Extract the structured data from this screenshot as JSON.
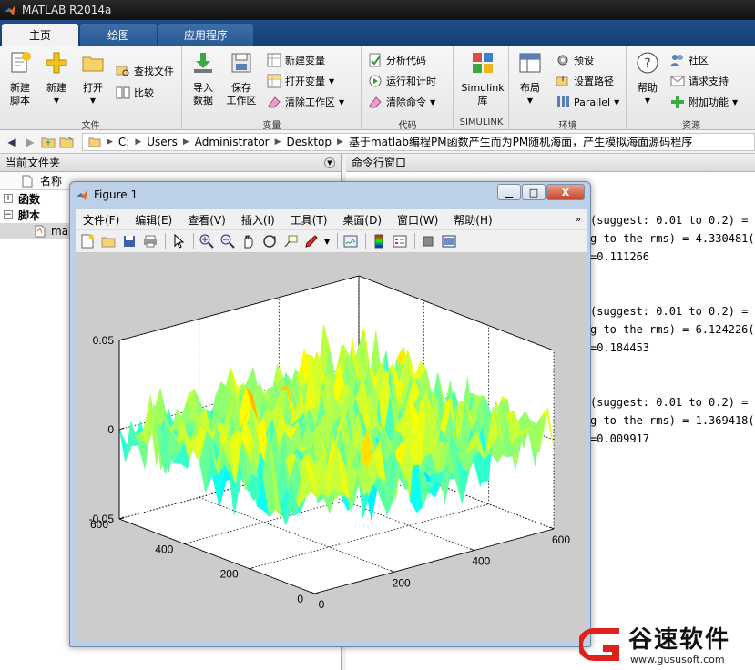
{
  "app": {
    "title": "MATLAB R2014a"
  },
  "tabs": [
    {
      "label": "主页",
      "active": true
    },
    {
      "label": "绘图",
      "active": false
    },
    {
      "label": "应用程序",
      "active": false
    }
  ],
  "ribbon": {
    "file": {
      "label": "文件",
      "new_script": "新建\n脚本",
      "new": "新建",
      "open": "打开",
      "find_files": "查找文件",
      "compare": "比较"
    },
    "variable": {
      "label": "变量",
      "import_data": "导入\n数据",
      "save_workspace": "保存\n工作区",
      "new_variable": "新建变量",
      "open_variable": "打开变量",
      "clear_workspace": "清除工作区"
    },
    "code": {
      "label": "代码",
      "analyze_code": "分析代码",
      "run_and_time": "运行和计时",
      "clear_commands": "清除命令"
    },
    "simulink": {
      "label": "SIMULINK",
      "button": "Simulink\n库"
    },
    "environment": {
      "label": "环境",
      "layout": "布局",
      "preferences": "预设",
      "set_path": "设置路径",
      "parallel": "Parallel"
    },
    "resources": {
      "label": "资源",
      "help": "帮助",
      "community": "社区",
      "request_support": "请求支持",
      "add_ons": "附加功能"
    }
  },
  "address": {
    "crumbs": [
      "C:",
      "Users",
      "Administrator",
      "Desktop",
      "基于matlab编程PM函数产生而为PM随机海面，产生模拟海面源码程序"
    ]
  },
  "current_folder": {
    "title": "当前文件夹",
    "column_name": "名称",
    "items": [
      {
        "label": "函数",
        "expander": "+"
      },
      {
        "label": "脚本",
        "expander": "−"
      },
      {
        "label": "ma"
      }
    ]
  },
  "command_window": {
    "title": "命令行窗口",
    "lines": [
      "(suggest: 0.01 to 0.2) =",
      "g to the rms) = 4.330481(m",
      "=0.111266",
      "(suggest: 0.01 to 0.2) =",
      "g to the rms) = 6.124226(m",
      "=0.184453",
      "(suggest: 0.01 to 0.2) =",
      "g to the rms) = 1.369418(m",
      "=0.009917"
    ]
  },
  "figure": {
    "title": "Figure 1",
    "menu": [
      "文件(F)",
      "编辑(E)",
      "查看(V)",
      "插入(I)",
      "工具(T)",
      "桌面(D)",
      "窗口(W)",
      "帮助(H)"
    ],
    "menu_more": "»",
    "win_min": "▁",
    "win_max": "□",
    "win_close": "X"
  },
  "chart_data": {
    "type": "surface",
    "title": "",
    "xlabel": "",
    "ylabel": "",
    "zlabel": "",
    "z_ticks": [
      "0.05",
      "0",
      "-0.05"
    ],
    "z_range": [
      -0.05,
      0.05
    ],
    "x_ticks": [
      "0",
      "200",
      "400",
      "600"
    ],
    "y_ticks": [
      "0",
      "200",
      "400",
      "600"
    ],
    "x_range": [
      0,
      600
    ],
    "y_range": [
      0,
      600
    ],
    "colormap": "jet",
    "grid": true
  },
  "watermark": {
    "text": "谷速软件",
    "url": "www.gususoft.com"
  }
}
